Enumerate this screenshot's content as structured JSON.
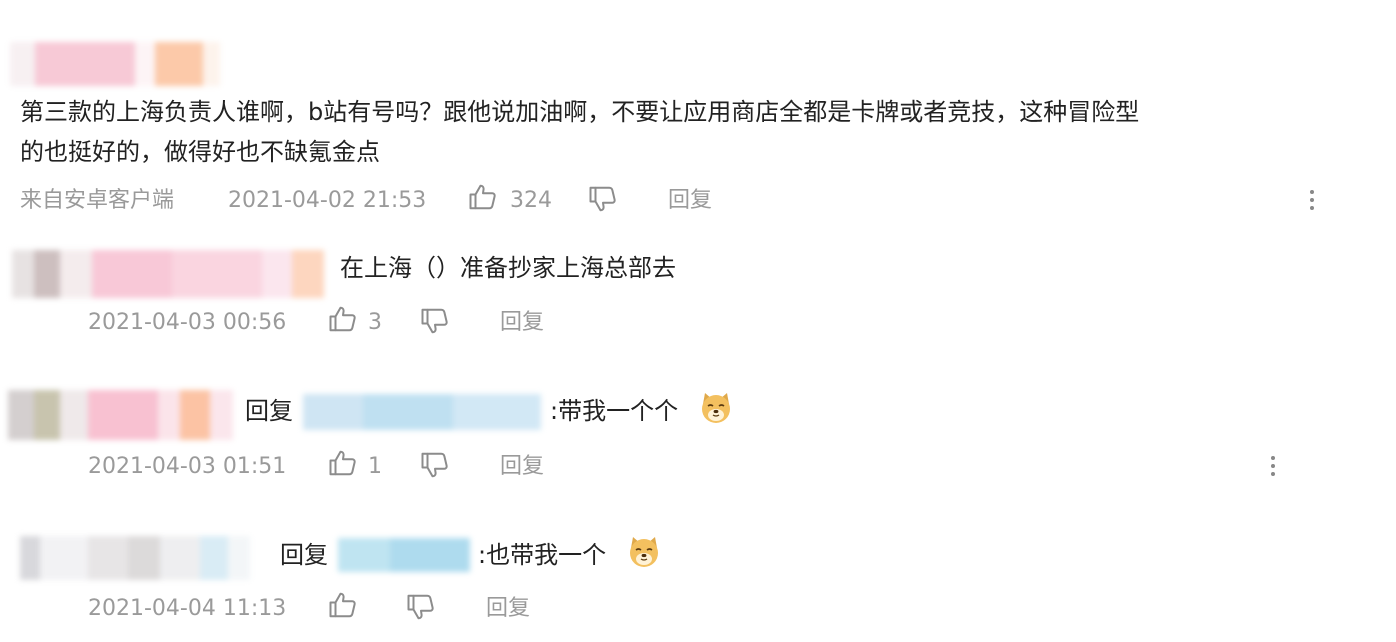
{
  "comments": [
    {
      "text_line1": "第三款的上海负责人谁啊，b站有号吗？跟他说加油啊，不要让应用商店全都是卡牌或者竞技，这种冒险型",
      "text_line2": "的也挺好的，做得好也不缺氪金点",
      "source": "来自安卓客户端",
      "timestamp": "2021-04-02 21:53",
      "likes": "324",
      "reply_label": "回复"
    },
    {
      "text": "在上海（）准备抄家上海总部去",
      "timestamp": "2021-04-03 00:56",
      "likes": "3",
      "reply_label": "回复"
    },
    {
      "reply_prefix": "回复",
      "text": ":带我一个个",
      "timestamp": "2021-04-03 01:51",
      "likes": "1",
      "reply_label": "回复"
    },
    {
      "reply_prefix": "回复",
      "text": ":也带我一个",
      "timestamp": "2021-04-04 11:13",
      "likes": "",
      "reply_label": "回复"
    }
  ],
  "icons": {
    "like": "thumbs-up-icon",
    "dislike": "thumbs-down-icon",
    "more": "more-vertical-icon",
    "emoji": "doge-emoji-icon"
  },
  "colors": {
    "text": "#222222",
    "meta": "#9a9a9a",
    "icon": "#8c8c8c"
  }
}
